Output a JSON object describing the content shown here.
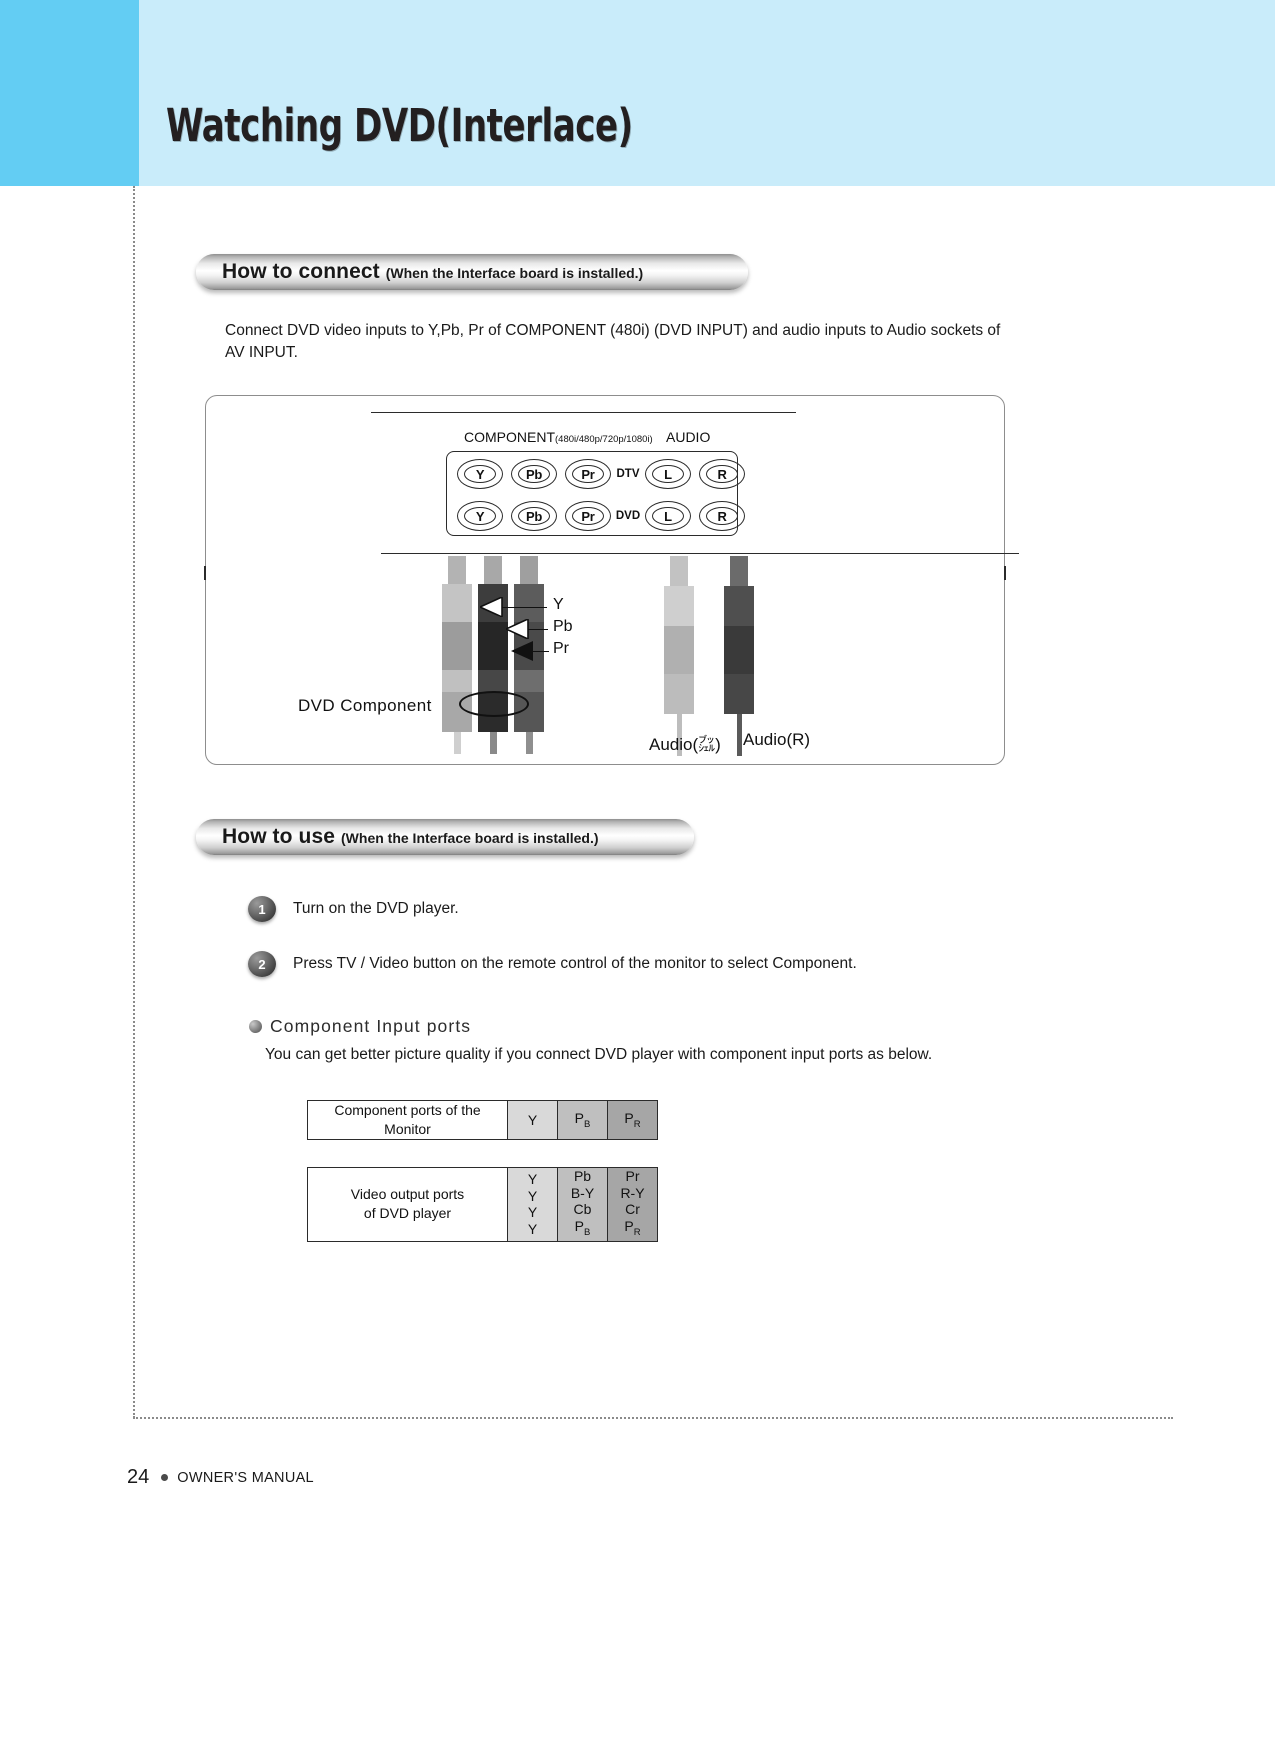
{
  "page": {
    "title": "Watching DVD(Interlace)",
    "footer_page_number": "24",
    "footer_label": "OWNER'S MANUAL"
  },
  "colors": {
    "header_band": "#c9ecfa",
    "header_tab": "#63cdf3",
    "title_text": "#231f20",
    "table_y": "#d9d9d9",
    "table_pb": "#bfbfbf",
    "table_pr": "#a6a6a6"
  },
  "sections": {
    "connect": {
      "banner_main": "How to connect",
      "banner_sub": "(When the Interface board is installed.)",
      "paragraph": "Connect DVD video inputs to Y,Pb, Pr of COMPONENT (480i) (DVD INPUT) and audio inputs to Audio sockets of AV INPUT."
    },
    "use": {
      "banner_main": "How to use",
      "banner_sub": "(When the Interface board is installed.)",
      "steps": [
        {
          "num": "1",
          "text": "Turn on the DVD player."
        },
        {
          "num": "2",
          "text": "Press TV / Video button on the remote control of the monitor to select Component."
        }
      ]
    }
  },
  "diagram": {
    "component_label": "COMPONENT",
    "component_suffix": "(480i/480p/720p/1080i)",
    "audio_label": "AUDIO",
    "rows": [
      {
        "source": "DTV",
        "jacks": [
          "Y",
          "Pb",
          "Pr"
        ],
        "audio": [
          "L",
          "R"
        ]
      },
      {
        "source": "DVD",
        "jacks": [
          "Y",
          "Pb",
          "Pr"
        ],
        "audio": [
          "L",
          "R"
        ]
      }
    ],
    "cable_labels": [
      "Y",
      "Pb",
      "Pr"
    ],
    "dvd_component_label": "DVD Component",
    "audio_left_label": "Audio(㌴)",
    "audio_right_label": "Audio(R)"
  },
  "component_input_ports": {
    "title": "Component Input ports",
    "description": "You can get better picture quality if you connect DVD player with component input ports as below.",
    "monitor_row": {
      "label": "Component ports of the Monitor",
      "label_line1": "Component ports of the",
      "label_line2": "Monitor",
      "values": [
        "Y",
        "PB",
        "PR"
      ],
      "values_display": [
        {
          "main": "Y",
          "sub": ""
        },
        {
          "main": "P",
          "sub": "B"
        },
        {
          "main": "P",
          "sub": "R"
        }
      ]
    },
    "dvd_row": {
      "label_line1": "Video output ports",
      "label_line2": "of DVD player",
      "col_y": [
        "Y",
        "Y",
        "Y",
        "Y"
      ],
      "col_pb": [
        "Pb",
        "B-Y",
        "Cb",
        "PB"
      ],
      "col_pr": [
        "Pr",
        "R-Y",
        "Cr",
        "PR"
      ]
    }
  }
}
